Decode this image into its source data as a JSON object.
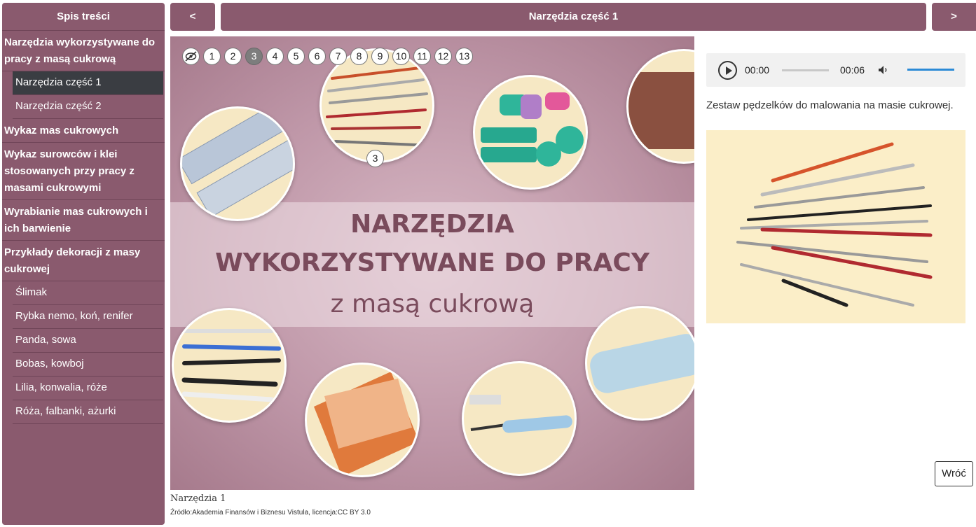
{
  "sidebar": {
    "title": "Spis treści",
    "items": [
      {
        "label": "Narzędzia wykorzystywane do pracy z masą cukrową",
        "level": 1
      },
      {
        "label": "Narzędzia część 1",
        "level": 2,
        "active": true
      },
      {
        "label": "Narzędzia część 2",
        "level": 2
      },
      {
        "label": "Wykaz mas cukrowych",
        "level": 1
      },
      {
        "label": "Wykaz surowców i klei stosowanych przy pracy z masami cukrowymi",
        "level": 1
      },
      {
        "label": "Wyrabianie mas cukrowych i ich barwienie",
        "level": 1
      },
      {
        "label": "Przykłady dekoracji z masy cukrowej",
        "level": 1
      },
      {
        "label": "Ślimak",
        "level": 2
      },
      {
        "label": "Rybka nemo, koń, renifer",
        "level": 2
      },
      {
        "label": "Panda, sowa",
        "level": 2
      },
      {
        "label": "Bobas, kowboj",
        "level": 2
      },
      {
        "label": "Lilia, konwalia, róże",
        "level": 2
      },
      {
        "label": "Róża, falbanki, ażurki",
        "level": 2
      }
    ]
  },
  "nav": {
    "prev_label": "<",
    "title": "Narzędzia część 1",
    "next_label": ">"
  },
  "illustration": {
    "headline_1": "NARZĘDZIA",
    "headline_2": "WYKORZYSTYWANE DO PRACY",
    "headline_3": "z masą cukrową",
    "hotspots": [
      "1",
      "2",
      "3",
      "4",
      "5",
      "6",
      "7",
      "8",
      "9",
      "10",
      "11",
      "12",
      "13"
    ],
    "active_hotspot": "3",
    "marker_label": "3",
    "eye_icon": "eye-slash-icon"
  },
  "caption": "Narzędzia 1",
  "source": "Źródło:Akademia Finansów i Biznesu Vistula, licencja:CC BY 3.0",
  "audio": {
    "current_time": "00:00",
    "duration": "00:06",
    "progress": 0,
    "volume": 1
  },
  "detail": {
    "description": "Zestaw pędzelków do malowania na masie cukrowej."
  },
  "back_label": "Wróć",
  "colors": {
    "accent": "#8a5a6e",
    "active_item": "#3a3d42",
    "headline": "#7a4b5c"
  }
}
